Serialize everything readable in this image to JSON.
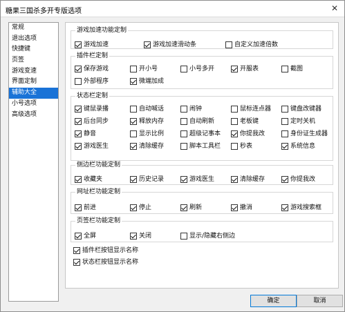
{
  "window": {
    "title": "糖果三国杀多开专版选项",
    "close_glyph": "✕"
  },
  "sidebar": {
    "items": [
      {
        "label": "常规",
        "selected": false
      },
      {
        "label": "退出选项",
        "selected": false
      },
      {
        "label": "快捷键",
        "selected": false
      },
      {
        "label": "页签",
        "selected": false
      },
      {
        "label": "游戏变速",
        "selected": false
      },
      {
        "label": "界面定制",
        "selected": false
      },
      {
        "label": "辅助大全",
        "selected": true
      },
      {
        "label": "小号选项",
        "selected": false
      },
      {
        "label": "高级选项",
        "selected": false
      }
    ]
  },
  "groups": {
    "game_accel": {
      "title": "游戏加速功能定制",
      "items": [
        {
          "label": "游戏加速",
          "checked": true
        },
        {
          "label": "游戏加速滑动条",
          "checked": true
        },
        {
          "label": "自定义加速倍数",
          "checked": false
        }
      ]
    },
    "plugin_bar": {
      "title": "插件栏定制",
      "items": [
        {
          "label": "保存游戏",
          "checked": true
        },
        {
          "label": "开小号",
          "checked": false
        },
        {
          "label": "小号多开",
          "checked": false
        },
        {
          "label": "开服表",
          "checked": true
        },
        {
          "label": "截图",
          "checked": false
        },
        {
          "label": "外部程序",
          "checked": false
        },
        {
          "label": "微端加成",
          "checked": true
        }
      ]
    },
    "status_bar": {
      "title": "状态栏定制",
      "items": [
        {
          "label": "键鼠录播",
          "checked": true
        },
        {
          "label": "自动喊话",
          "checked": false
        },
        {
          "label": "闹钟",
          "checked": false
        },
        {
          "label": "鼠标连点器",
          "checked": false
        },
        {
          "label": "键盘改键器",
          "checked": false
        },
        {
          "label": "后台同步",
          "checked": true
        },
        {
          "label": "释放内存",
          "checked": true
        },
        {
          "label": "自动刷新",
          "checked": false
        },
        {
          "label": "老板键",
          "checked": false
        },
        {
          "label": "定时关机",
          "checked": false
        },
        {
          "label": "静音",
          "checked": true
        },
        {
          "label": "显示比例",
          "checked": false
        },
        {
          "label": "超级记事本",
          "checked": false
        },
        {
          "label": "你提我改",
          "checked": true
        },
        {
          "label": "身份证生成器",
          "checked": false
        },
        {
          "label": "游戏医生",
          "checked": true
        },
        {
          "label": "清除缓存",
          "checked": true
        },
        {
          "label": "脚本工具栏",
          "checked": false
        },
        {
          "label": "秒表",
          "checked": false
        },
        {
          "label": "系统信息",
          "checked": true
        }
      ]
    },
    "side_bar": {
      "title": "侧边栏功能定制",
      "items": [
        {
          "label": "收藏夹",
          "checked": true
        },
        {
          "label": "历史记录",
          "checked": true
        },
        {
          "label": "游戏医生",
          "checked": true
        },
        {
          "label": "清除缓存",
          "checked": true
        },
        {
          "label": "你提我改",
          "checked": true
        }
      ]
    },
    "url_bar": {
      "title": "网址栏功能定制",
      "items": [
        {
          "label": "前进",
          "checked": true
        },
        {
          "label": "停止",
          "checked": true
        },
        {
          "label": "刷新",
          "checked": true
        },
        {
          "label": "撤消",
          "checked": true
        },
        {
          "label": "游戏搜索框",
          "checked": true
        }
      ]
    },
    "tab_bar": {
      "title": "页签栏功能定制",
      "items": [
        {
          "label": "全屏",
          "checked": true
        },
        {
          "label": "关闭",
          "checked": true
        },
        {
          "label": "显示/隐藏右侧边",
          "checked": false
        }
      ]
    }
  },
  "extra_options": [
    {
      "label": "插件栏按钮显示名称",
      "checked": true
    },
    {
      "label": "状态栏按钮显示名称",
      "checked": true
    }
  ],
  "buttons": {
    "ok": "确定",
    "cancel": "取消"
  }
}
